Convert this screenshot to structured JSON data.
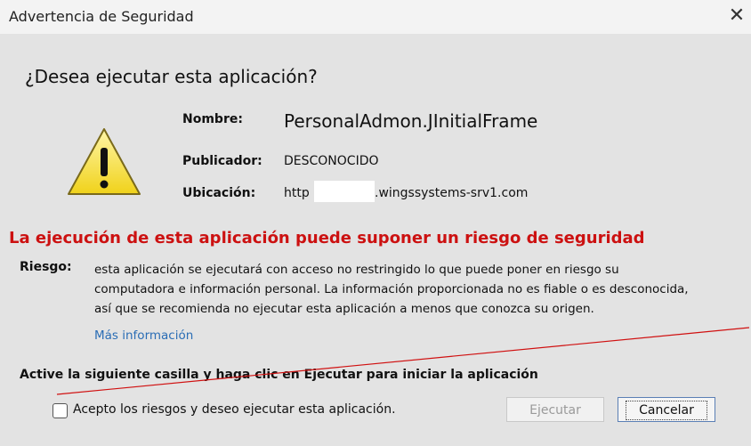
{
  "window": {
    "title": "Advertencia de Seguridad",
    "close_glyph": "✕"
  },
  "question": "¿Desea ejecutar esta aplicación?",
  "details": {
    "name_label": "Nombre:",
    "name_value": "PersonalAdmon.JInitialFrame",
    "publisher_label": "Publicador:",
    "publisher_value": "DESCONOCIDO",
    "location_label": "Ubicación:",
    "location_prefix": "http",
    "location_suffix": ".wingssystems-srv1.com"
  },
  "risk": {
    "title": "La ejecución de esta aplicación puede suponer un riesgo de seguridad",
    "label": "Riesgo:",
    "lines": [
      "esta aplicación se ejecutará con acceso no restringido lo que puede poner en riesgo su",
      "computadora e información personal. La información proporcionada no es fiable o es desconocida,",
      "así que se recomienda no ejecutar esta aplicación a menos que conozca su origen."
    ],
    "more_info": "Más información"
  },
  "activate_text": "Active la siguiente casilla y haga clic en Ejecutar para iniciar la aplicación",
  "accept_checkbox": {
    "label": "Acepto los riesgos y deseo ejecutar esta aplicación.",
    "checked": false
  },
  "buttons": {
    "execute": "Ejecutar",
    "cancel": "Cancelar"
  },
  "colors": {
    "warning_red": "#cc1111",
    "link_blue": "#2a6db5",
    "icon_yellow": "#f5e23a"
  }
}
